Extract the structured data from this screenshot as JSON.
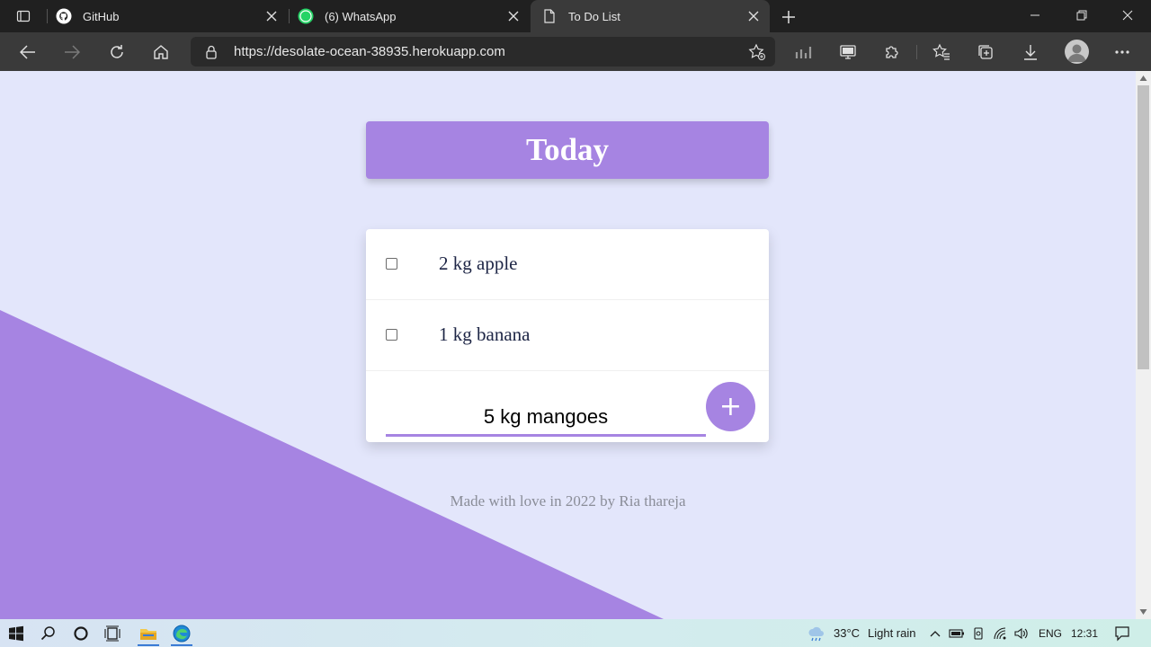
{
  "browser": {
    "tabs": [
      {
        "title": "GitHub",
        "icon": "github-icon",
        "active": false
      },
      {
        "title": "(6) WhatsApp",
        "icon": "whatsapp-icon",
        "badge": "6",
        "active": false
      },
      {
        "title": "To Do List",
        "icon": "page-icon",
        "active": true
      }
    ],
    "url": "https://desolate-ocean-38935.herokuapp.com"
  },
  "page": {
    "heading": "Today",
    "items": [
      {
        "text": "2 kg apple",
        "checked": false
      },
      {
        "text": "1 kg banana",
        "checked": false
      }
    ],
    "new_item_value": "5 kg mangoes",
    "add_button_label": "+",
    "footer": "Made with love in 2022 by Ria thareja",
    "colors": {
      "accent": "#a684e2",
      "background": "#e3e6fb"
    }
  },
  "taskbar": {
    "weather_temp": "33°C",
    "weather_desc": "Light rain",
    "language": "ENG",
    "time": "12:31"
  }
}
